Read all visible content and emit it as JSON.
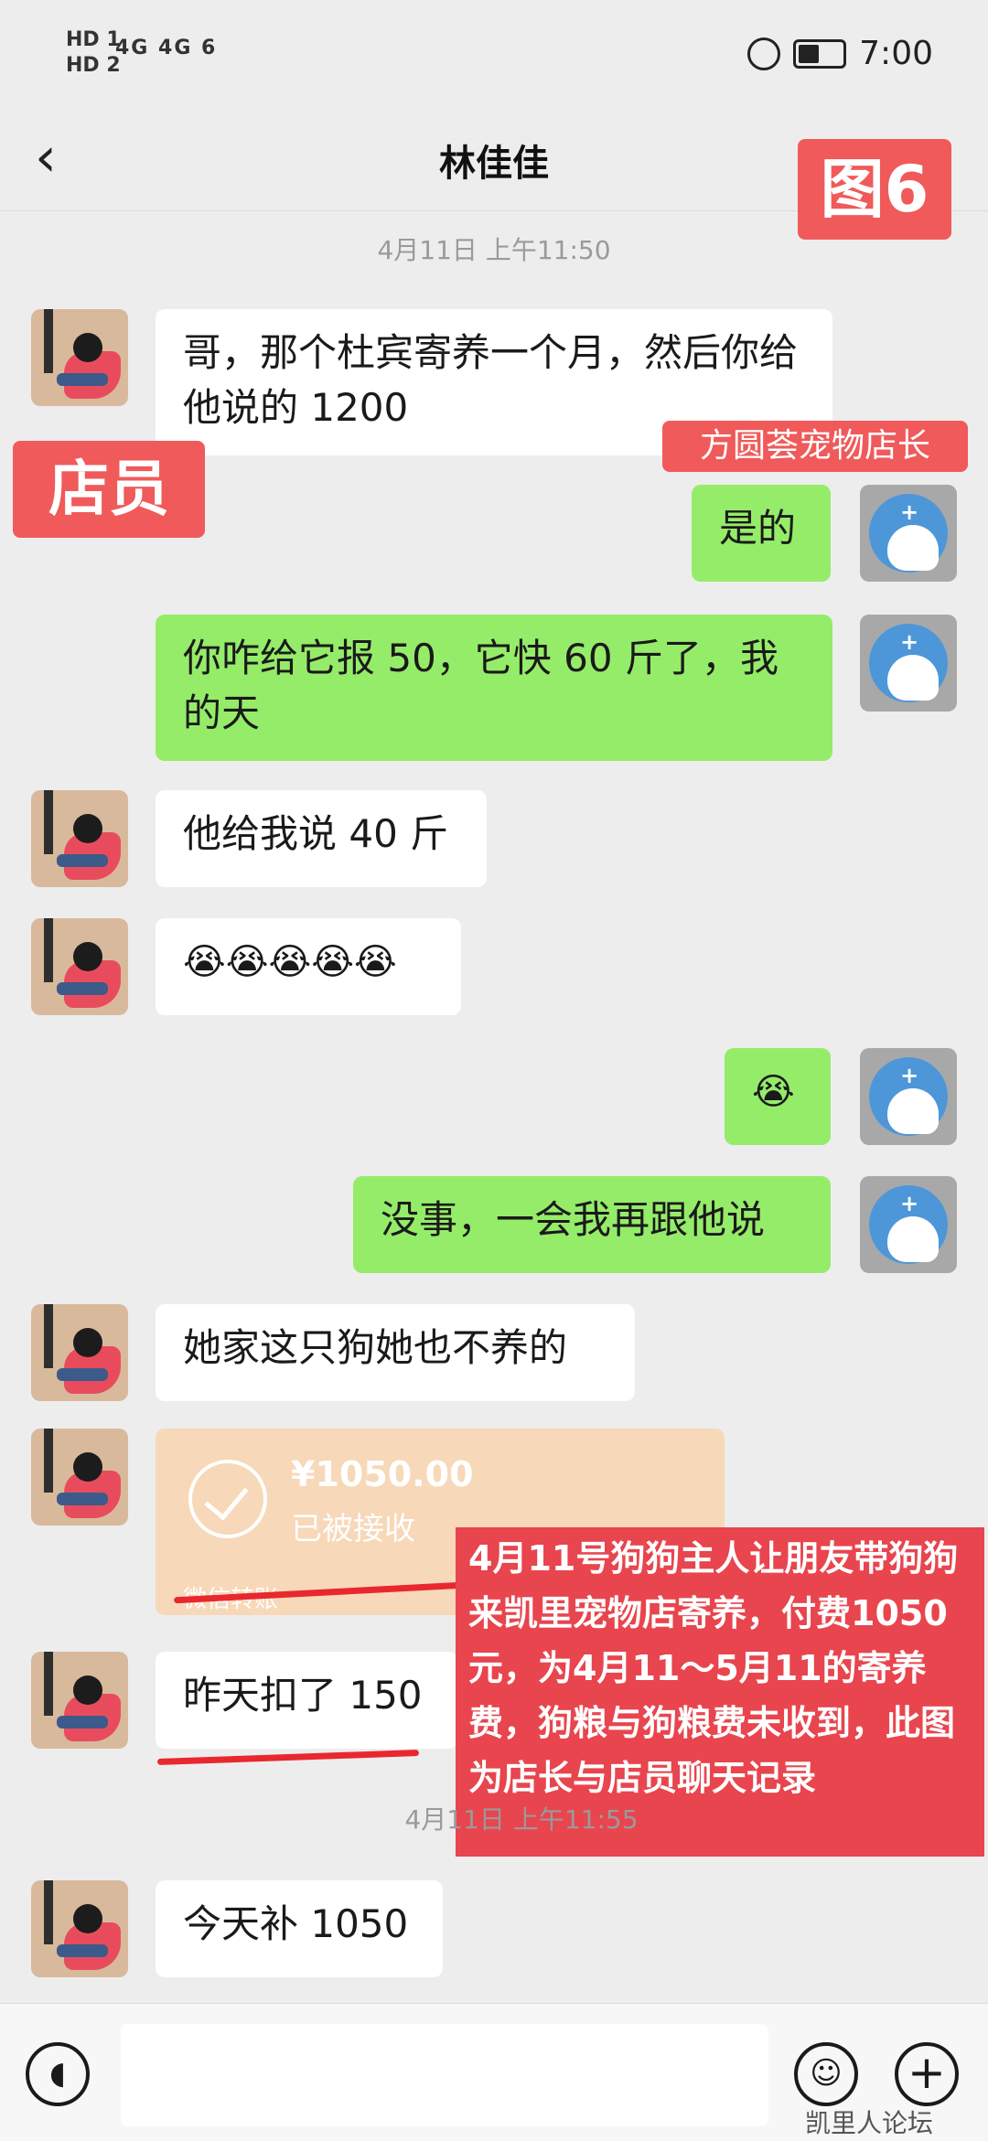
{
  "status_bar": {
    "left_top": "HD 1",
    "left_bottom": "HD 2",
    "network": "4G  4G  6",
    "time": "7:00"
  },
  "nav": {
    "title": "林佳佳"
  },
  "annotations": {
    "figure": "图6",
    "staff": "店员",
    "owner": "方圆荟宠物店长"
  },
  "timestamps": [
    "4月11日 上午11:50",
    "4月11日 上午11:55"
  ],
  "messages": [
    {
      "side": "left",
      "text": "哥，那个杜宾寄养一个月，然后你给他说的 1200"
    },
    {
      "side": "right",
      "text": "是的"
    },
    {
      "side": "right",
      "text": "你咋给它报 50，它快 60 斤了，我的天"
    },
    {
      "side": "left",
      "text": "他给我说 40 斤"
    },
    {
      "side": "left",
      "text": "😭😭😭😭😭"
    },
    {
      "side": "right",
      "text": "😭"
    },
    {
      "side": "right",
      "text": "没事，一会我再跟他说"
    },
    {
      "side": "left",
      "text": "她家这只狗她也不养的"
    },
    {
      "side": "left",
      "text": "昨天扣了 150"
    },
    {
      "side": "left",
      "text": "今天补 1050"
    }
  ],
  "transfer": {
    "amount": "¥1050.00",
    "status": "已被接收",
    "label": "微信转账"
  },
  "note": {
    "text": "4月11号狗狗主人让朋友带狗狗来凯里宠物店寄养，付费1050元，为4月11～5月11的寄养费，狗粮与狗粮费未收到，此图为店长与店员聊天记录"
  },
  "watermark": "凯里人论坛"
}
